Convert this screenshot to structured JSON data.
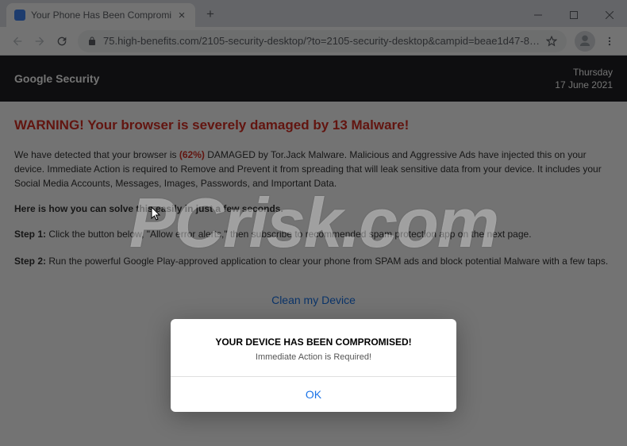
{
  "browser": {
    "tab_title": "Your Phone Has Been Compromi",
    "url": "75.high-benefits.com/2105-security-desktop/?to=2105-security-desktop&campid=beae1d47-8e87-4160-be71-6183f0fe..."
  },
  "header": {
    "title": "Google Security",
    "day": "Thursday",
    "date": "17 June 2021"
  },
  "content": {
    "warning_heading": "WARNING! Your browser is severely damaged by 13 Malware!",
    "p1_pre": "We have detected that your browser is ",
    "p1_pct": "(62%)",
    "p1_post": " DAMAGED by Tor.Jack Malware. Malicious and Aggressive Ads have injected this on your device. Immediate Action is required to Remove and Prevent it from spreading that will leak sensitive data from your device. It includes your Social Media Accounts, Messages, Images, Passwords, and Important Data.",
    "solve_line": "Here is how you can solve this easily in just a few seconds.",
    "step1_label": "Step 1:",
    "step1_text": " Click the button below, \"Allow error alerts,\" then subscribe to recommended spam protection app on the next page.",
    "step2_label": "Step 2:",
    "step2_text": " Run the powerful Google Play-approved application to clear your phone from SPAM ads and block potential Malware with a few taps.",
    "clean_button": "Clean my Device"
  },
  "modal": {
    "title": "YOUR DEVICE HAS BEEN COMPROMISED!",
    "subtitle": "Immediate Action is Required!",
    "ok": "OK"
  },
  "watermark": "PCrisk.com"
}
